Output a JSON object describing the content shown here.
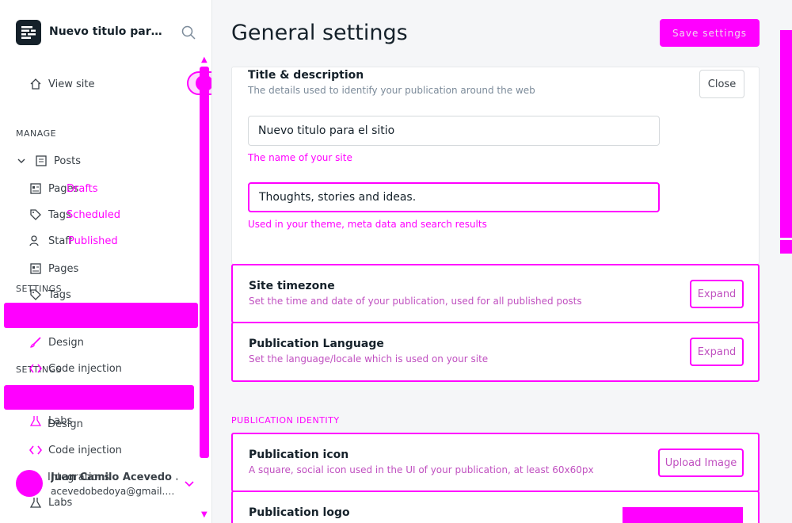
{
  "sidebar": {
    "site_title": "Nuevo titulo para ...",
    "view_site": "View site",
    "manage_label": "MANAGE",
    "settings_label_1": "SETTINGS",
    "settings_label_2": "SETTINGS",
    "items": [
      {
        "label": "Posts"
      },
      {
        "label": "Pages"
      },
      {
        "label": "Drafts"
      },
      {
        "label": "Tags"
      },
      {
        "label": "Scheduled"
      },
      {
        "label": "Staff"
      },
      {
        "label": "Published"
      },
      {
        "label": "Pages"
      },
      {
        "label": "Tags"
      },
      {
        "label": "Design"
      },
      {
        "label": "Code injection"
      },
      {
        "label": "Labs"
      },
      {
        "label": "Design"
      },
      {
        "label": "Code injection"
      },
      {
        "label": "Integrations"
      },
      {
        "label": "Labs"
      }
    ],
    "user": {
      "name": "Juan Camilo Acevedo ...",
      "email": "acevedobedoya@gmail.c..."
    }
  },
  "main": {
    "title": "General settings",
    "save_label": "Save settings",
    "title_card": {
      "title": "Title & description",
      "desc": "The details used to identify your publication around the web",
      "close_label": "Close",
      "site_name_value": "Nuevo titulo para el sitio",
      "site_name_hint": "The name of your site",
      "description_value": "Thoughts, stories and ideas.",
      "description_hint": "Used in your theme, meta data and search results"
    },
    "timezone_card": {
      "title": "Site timezone",
      "desc": "Set the time and date of your publication, used for all published posts",
      "button": "Expand"
    },
    "language_card": {
      "title": "Publication Language",
      "desc": "Set the language/locale which is used on your site",
      "button": "Expand"
    },
    "identity_section": "PUBLICATION IDENTITY",
    "icon_card": {
      "title": "Publication icon",
      "desc": "A square, social icon used in the UI of your publication, at least 60x60px",
      "button": "Upload Image"
    },
    "logo_card": {
      "title": "Publication logo"
    }
  },
  "colors": {
    "accent": "#ff00ff",
    "sidebar_bg": "#ffffff",
    "main_bg": "#f5f6f8",
    "text": "#15212a"
  }
}
